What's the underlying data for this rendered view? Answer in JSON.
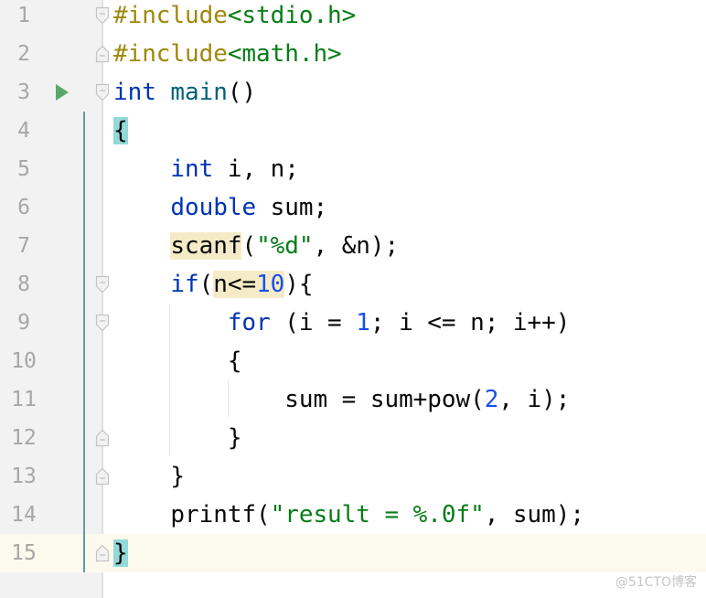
{
  "editor": {
    "language": "C",
    "current_line": 15,
    "lines": [
      {
        "number": "1",
        "tokens": [
          {
            "t": "pp",
            "v": "#include"
          },
          {
            "t": "str",
            "v": "<stdio.h>"
          }
        ]
      },
      {
        "number": "2",
        "tokens": [
          {
            "t": "pp",
            "v": "#include"
          },
          {
            "t": "str",
            "v": "<math.h>"
          }
        ]
      },
      {
        "number": "3",
        "tokens": [
          {
            "t": "kw",
            "v": "int"
          },
          {
            "t": "",
            "v": " "
          },
          {
            "t": "fn",
            "v": "main"
          },
          {
            "t": "",
            "v": "()"
          }
        ]
      },
      {
        "number": "4",
        "tokens": [
          {
            "t": "hl-match",
            "v": "{"
          }
        ]
      },
      {
        "number": "5",
        "tokens": [
          {
            "t": "",
            "v": "    "
          },
          {
            "t": "kw",
            "v": "int"
          },
          {
            "t": "",
            "v": " i, n;"
          }
        ]
      },
      {
        "number": "6",
        "tokens": [
          {
            "t": "",
            "v": "    "
          },
          {
            "t": "kw",
            "v": "double"
          },
          {
            "t": "",
            "v": " sum;"
          }
        ]
      },
      {
        "number": "7",
        "tokens": [
          {
            "t": "",
            "v": "    "
          },
          {
            "t": "hl-usage",
            "v": "scanf"
          },
          {
            "t": "",
            "v": "("
          },
          {
            "t": "str",
            "v": "\"%d\""
          },
          {
            "t": "",
            "v": ", &n);"
          }
        ]
      },
      {
        "number": "8",
        "tokens": [
          {
            "t": "",
            "v": "    "
          },
          {
            "t": "kw",
            "v": "if"
          },
          {
            "t": "",
            "v": "("
          },
          {
            "t": "hl-usage",
            "v": "n<="
          },
          {
            "t": "hl-usage num",
            "v": "10"
          },
          {
            "t": "",
            "v": "){"
          }
        ]
      },
      {
        "number": "9",
        "tokens": [
          {
            "t": "",
            "v": "        "
          },
          {
            "t": "kw",
            "v": "for"
          },
          {
            "t": "",
            "v": " (i = "
          },
          {
            "t": "num",
            "v": "1"
          },
          {
            "t": "",
            "v": "; i <= n; i++)"
          }
        ]
      },
      {
        "number": "10",
        "tokens": [
          {
            "t": "",
            "v": "        {"
          }
        ]
      },
      {
        "number": "11",
        "tokens": [
          {
            "t": "",
            "v": "            sum = sum+pow("
          },
          {
            "t": "num",
            "v": "2"
          },
          {
            "t": "",
            "v": ", i);"
          }
        ]
      },
      {
        "number": "12",
        "tokens": [
          {
            "t": "",
            "v": "        }"
          }
        ]
      },
      {
        "number": "13",
        "tokens": [
          {
            "t": "",
            "v": "    }"
          }
        ]
      },
      {
        "number": "14",
        "tokens": [
          {
            "t": "",
            "v": "    printf("
          },
          {
            "t": "str",
            "v": "\"result = %.0f\""
          },
          {
            "t": "",
            "v": ", sum);"
          }
        ]
      },
      {
        "number": "15",
        "tokens": [
          {
            "t": "hl-match",
            "v": "}"
          }
        ]
      }
    ],
    "run_icon_line": 3,
    "fold_markers": [
      {
        "line": 1,
        "kind": "open"
      },
      {
        "line": 2,
        "kind": "close"
      },
      {
        "line": 3,
        "kind": "open"
      },
      {
        "line": 8,
        "kind": "open"
      },
      {
        "line": 9,
        "kind": "open"
      },
      {
        "line": 12,
        "kind": "close"
      },
      {
        "line": 13,
        "kind": "close"
      },
      {
        "line": 15,
        "kind": "close"
      }
    ]
  },
  "watermark": "@51CTO博客"
}
